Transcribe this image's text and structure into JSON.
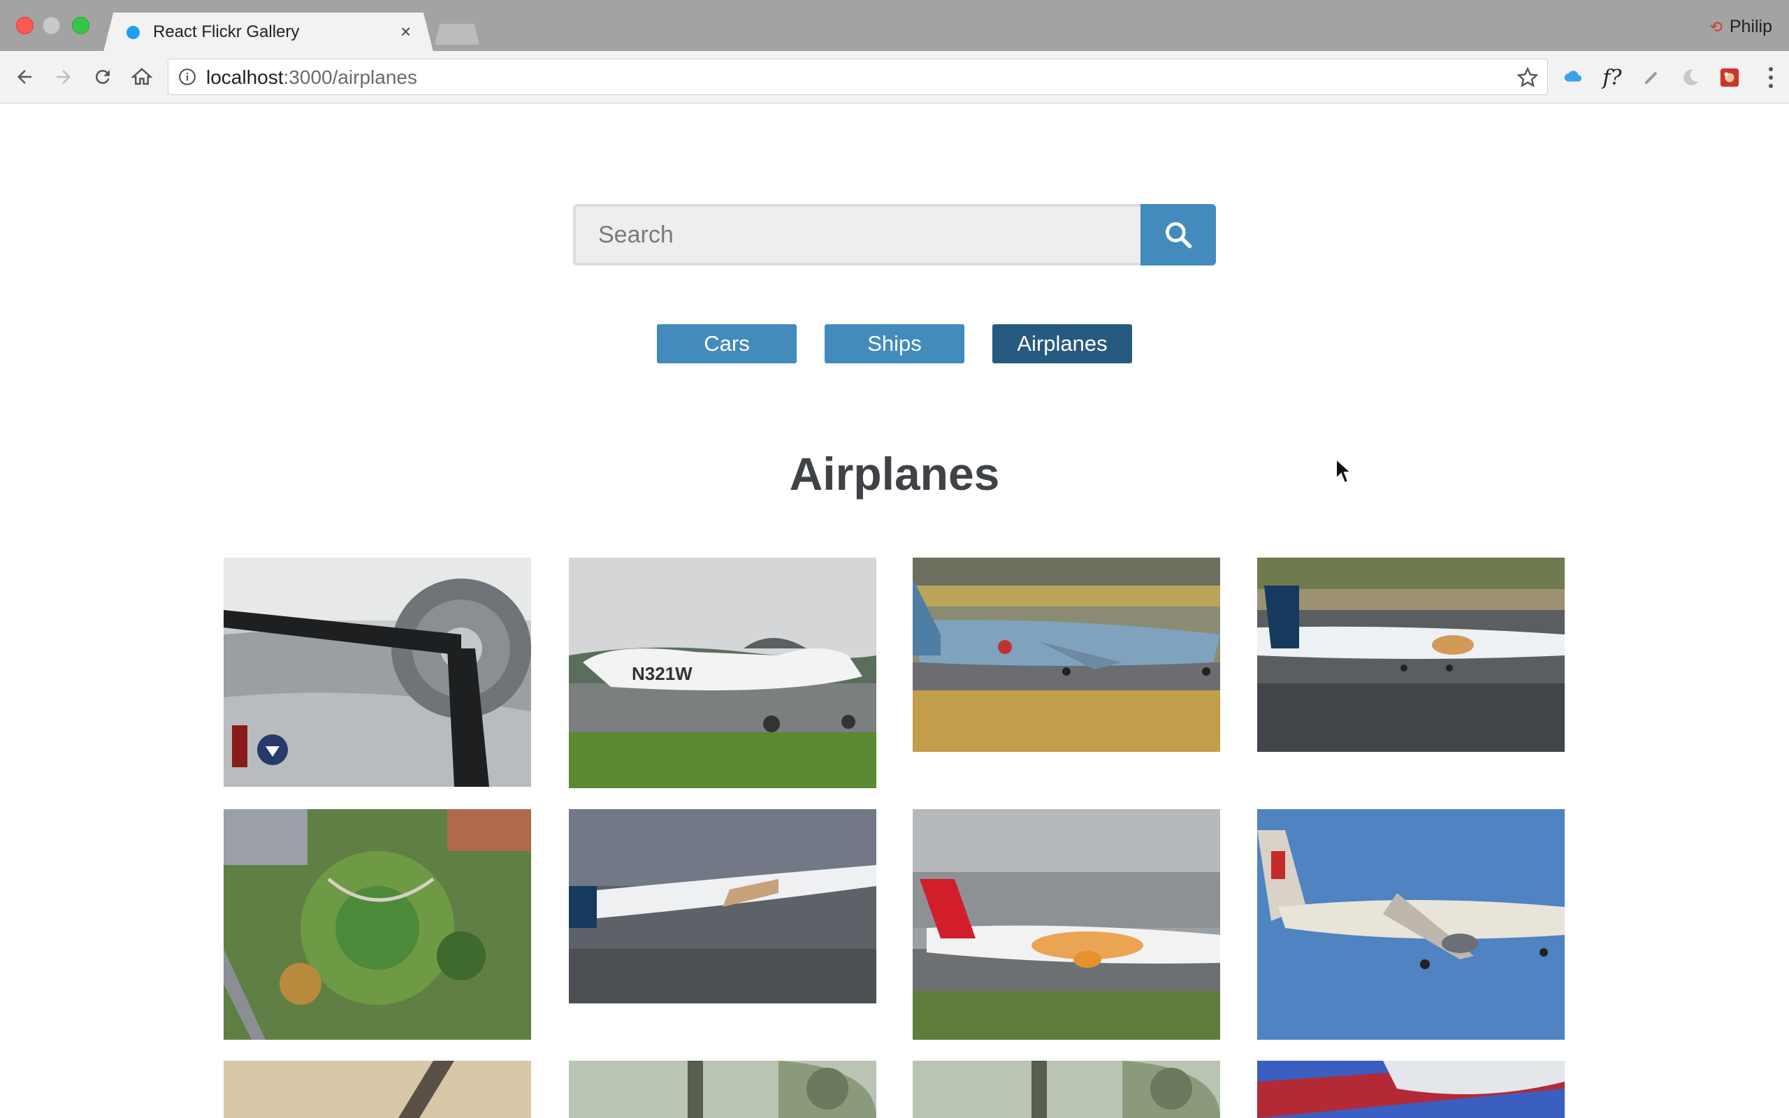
{
  "browser": {
    "tab_title": "React Flickr Gallery",
    "tab_close": "×",
    "profile_name": "Philip",
    "url_host": "localhost",
    "url_path": ":3000/airplanes",
    "ext_font_label": "f?"
  },
  "search": {
    "placeholder": "Search"
  },
  "nav": {
    "items": [
      {
        "label": "Cars",
        "active": false
      },
      {
        "label": "Ships",
        "active": false
      },
      {
        "label": "Airplanes",
        "active": true
      }
    ]
  },
  "gallery": {
    "title": "Airplanes",
    "photo_count_visible": 12
  },
  "colors": {
    "accent": "#438bbd",
    "accent_active": "#275a7f",
    "title_text": "#3f4246"
  }
}
